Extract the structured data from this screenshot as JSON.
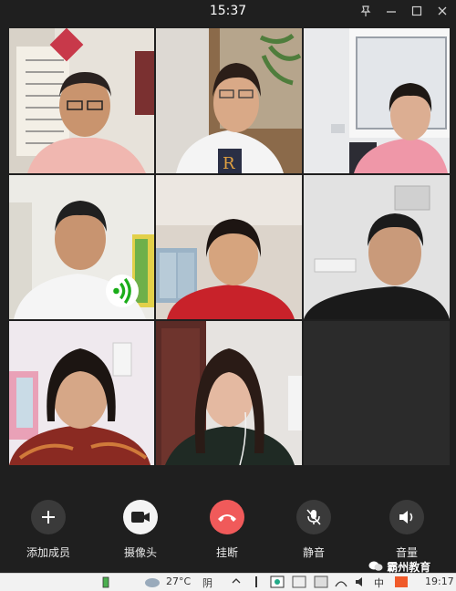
{
  "titlebar": {
    "time": "15:37"
  },
  "controls": [
    {
      "id": "add-member",
      "label": "添加成员",
      "icon": "plus-icon"
    },
    {
      "id": "camera",
      "label": "摄像头",
      "icon": "video-camera-icon"
    },
    {
      "id": "hangup",
      "label": "挂断",
      "icon": "hang-up-phone-icon"
    },
    {
      "id": "mute",
      "label": "静音",
      "icon": "muted-microphone-icon"
    },
    {
      "id": "volume",
      "label": "音量",
      "icon": "speaker-icon"
    }
  ],
  "taskbar": {
    "weather": "27°C",
    "weather_word": "阴",
    "ime": "中",
    "clock": "19:17"
  },
  "watermark": {
    "text": "霸州教育"
  },
  "colors": {
    "background": "#1f1f1f",
    "hangup": "#f05a5a",
    "speaking": "#1aad19"
  }
}
